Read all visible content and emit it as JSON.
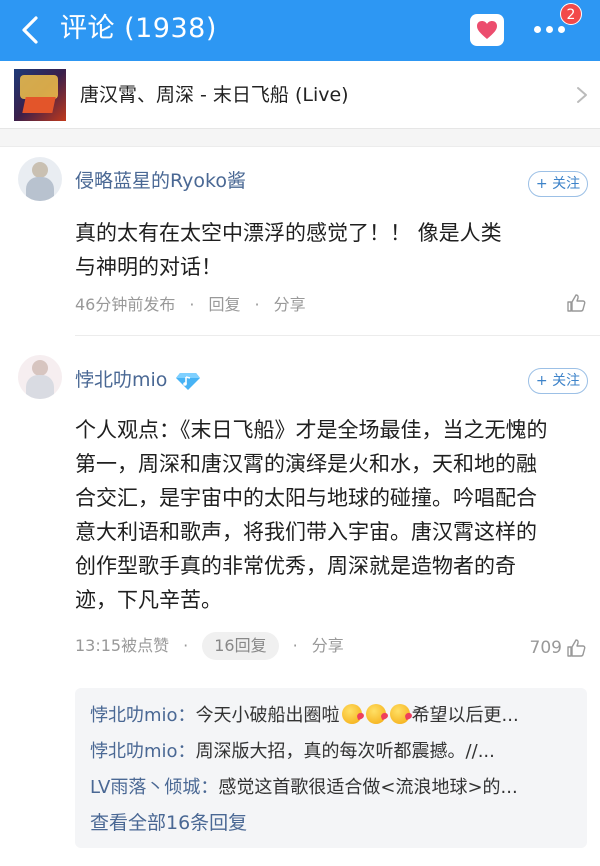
{
  "header": {
    "back_icon": "back-chevron-icon",
    "title": "评论 (1938)",
    "heart_icon": "heart-icon",
    "more_icon": "more-dots-icon",
    "badge_count": "2",
    "colors": {
      "bar": "#2d97f3",
      "badge": "#f24a4a",
      "heart": "#ec4d6e"
    }
  },
  "song": {
    "name": "唐汉霄、周深 - 末日飞船 (Live)",
    "arrow_icon": "chevron-right-icon"
  },
  "comments": [
    {
      "username": "侵略蓝星的Ryoko酱",
      "follow_label": "+ 关注",
      "content": "真的太有在太空中漂浮的感觉了！！ 像是人类与神明的对话！",
      "time": "46分钟前发布",
      "reply_label": "回复",
      "share_label": "分享",
      "like_icon": "thumbs-up-icon"
    },
    {
      "username": "悖北叻mio",
      "vip_icon": "diamond-vip-icon",
      "follow_label": "+ 关注",
      "content": "个人观点：《末日飞船》才是全场最佳，当之无愧的第一，周深和唐汉霄的演绎是火和水，天和地的融合交汇，是宇宙中的太阳与地球的碰撞。吟唱配合意大利语和歌声，将我们带入宇宙。唐汉霄这样的创作型歌手真的非常优秀，周深就是造物者的奇迹，下凡辛苦。",
      "time": "13:15被点赞",
      "reply_pill": "16回复",
      "share_label": "分享",
      "likes": "709",
      "like_icon": "thumbs-up-icon",
      "replies": [
        {
          "user": "悖北叻mio：",
          "text_before": "今天小破船出圈啦",
          "emoji_count": 3,
          "text_after": "希望以后更..."
        },
        {
          "user": "悖北叻mio：",
          "text_before": "周深版大招，真的每次听都震撼。//...",
          "emoji_count": 0,
          "text_after": ""
        },
        {
          "user": "LV雨落丶倾城：",
          "text_before": "感觉这首歌很适合做<流浪地球>的...",
          "emoji_count": 0,
          "text_after": ""
        }
      ],
      "view_all": "查看全部16条回复"
    }
  ]
}
